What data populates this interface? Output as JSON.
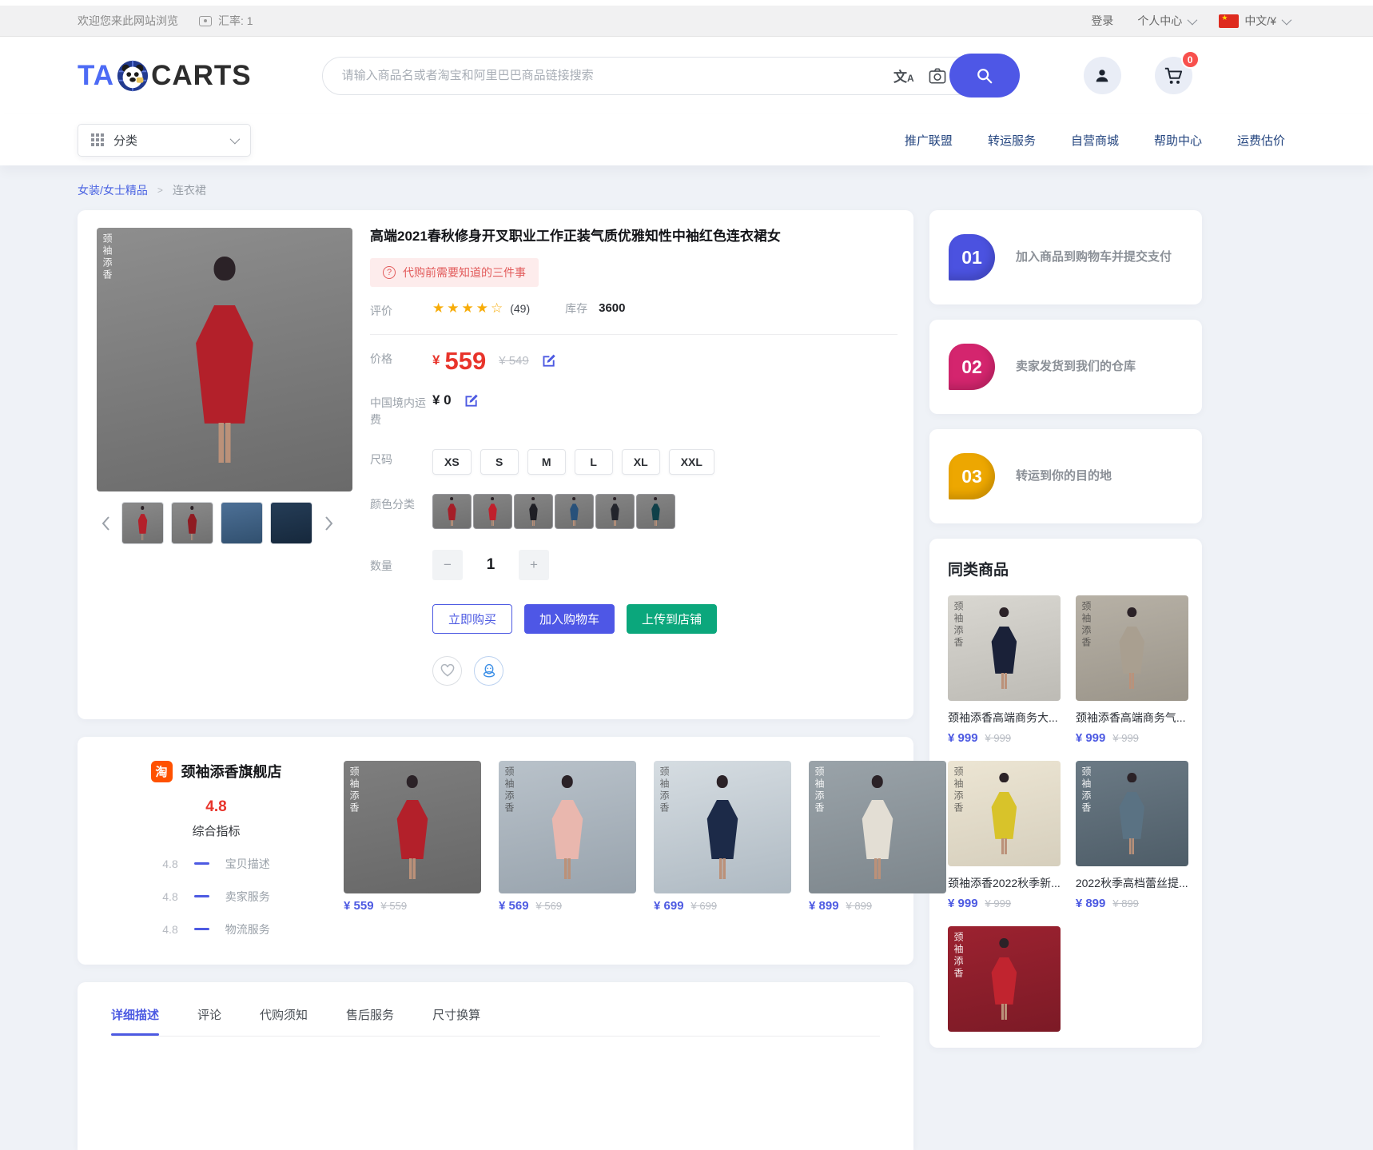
{
  "colors": {
    "accent_indigo": "#4e57e6",
    "price_red": "#e8342b",
    "green": "#0ba77c",
    "taobao_orange": "#ff5100",
    "badge_red": "#f8504d",
    "step1": "#4b52e0",
    "step2": "#d4256e",
    "step3": "#eda701",
    "nav_link": "#24457f",
    "star_gold": "#f7ac08"
  },
  "brand": {
    "logo_left": "TA",
    "logo_right": "CARTS",
    "watermark": "颈袖添香"
  },
  "topbar": {
    "welcome": "欢迎您来此网站浏览",
    "rate": "汇率: 1",
    "login": "登录",
    "account": "个人中心",
    "lang": "中文/¥"
  },
  "search": {
    "placeholder": "请输入商品名或者淘宝和阿里巴巴商品链接搜索",
    "cart_badge": "0"
  },
  "nav": {
    "category": "分类",
    "links": [
      "推广联盟",
      "转运服务",
      "自营商城",
      "帮助中心",
      "运费估价"
    ]
  },
  "breadcrumb": {
    "parent": "女装/女士精品",
    "sep": ">",
    "current": "连衣裙"
  },
  "product": {
    "title": "高端2021春秋修身开叉职业工作正装气质优雅知性中袖红色连衣裙女",
    "notice": "代购前需要知道的三件事",
    "labels": {
      "rating": "评价",
      "stock": "库存",
      "price": "价格",
      "shipping": "中国境内运费",
      "size": "尺码",
      "color": "颜色分类",
      "qty": "数量"
    },
    "rating_stars": "★★★★",
    "rating_half": "☆",
    "rating_count": "(49)",
    "stock": "3600",
    "currency": "¥",
    "price": "559",
    "old_price": "¥ 549",
    "shipping_fee": "¥ 0",
    "sizes": [
      "XS",
      "S",
      "M",
      "L",
      "XL",
      "XXL"
    ],
    "qty": "1",
    "minus": "−",
    "plus": "+",
    "buttons": {
      "buy": "立即购买",
      "cart": "加入购物车",
      "upload": "上传到店铺"
    },
    "main_img": {
      "bg1": "#8e8e8e",
      "bg2": "#6a6a6a",
      "dress": "#b3202a"
    },
    "thumbs": [
      {
        "bg1": "#8a8a8a",
        "bg2": "#707070",
        "dress": "#b3202a"
      },
      {
        "bg1": "#8a8a8a",
        "bg2": "#707070",
        "dress": "#8f1b22"
      },
      {
        "bg1": "#4d7096",
        "bg2": "#31506f",
        "dress": ""
      },
      {
        "bg1": "#253d57",
        "bg2": "#16283c",
        "dress": ""
      }
    ],
    "swatches": [
      "#a51e28",
      "#c0202c",
      "#1e1e24",
      "#28517a",
      "#22242b",
      "#104049"
    ]
  },
  "steps": [
    {
      "num": "01",
      "text": "加入商品到购物车并提交支付"
    },
    {
      "num": "02",
      "text": "卖家发货到我们的仓库"
    },
    {
      "num": "03",
      "text": "转运到你的目的地"
    }
  ],
  "similar": {
    "title": "同类商品",
    "items": [
      {
        "name": "颈袖添香高端商务大...",
        "price": "¥ 999",
        "old": "¥ 999",
        "img": {
          "bg1": "#d9d7d1",
          "bg2": "#bdbbb5",
          "dress": "#1a2138"
        }
      },
      {
        "name": "颈袖添香高端商务气...",
        "price": "¥ 999",
        "old": "¥ 999",
        "img": {
          "bg1": "#b7b1a6",
          "bg2": "#9b958a",
          "dress": "#a99f90"
        }
      },
      {
        "name": "颈袖添香2022秋季新...",
        "price": "¥ 999",
        "old": "¥ 999",
        "img": {
          "bg1": "#ece5d3",
          "bg2": "#d6cfbd",
          "dress": "#d8c32a"
        }
      },
      {
        "name": "2022秋季高档蕾丝提...",
        "price": "¥ 899",
        "old": "¥ 899",
        "img": {
          "bg1": "#6b7a85",
          "bg2": "#4e5d68",
          "dress": "#5a7283"
        }
      },
      {
        "name": "",
        "price": "",
        "old": "",
        "img": {
          "bg1": "#9c2230",
          "bg2": "#7c1a26",
          "dress": "#c1242f"
        }
      }
    ]
  },
  "shop": {
    "tao": "淘",
    "name": "颈袖添香旗舰店",
    "score": "4.8",
    "score_label": "综合指标",
    "metrics": [
      {
        "value": "4.8",
        "label": "宝贝描述"
      },
      {
        "value": "4.8",
        "label": "卖家服务"
      },
      {
        "value": "4.8",
        "label": "物流服务"
      }
    ],
    "items": [
      {
        "price": "¥ 559",
        "old": "¥ 559",
        "img": {
          "bg1": "#7e7e7e",
          "bg2": "#676767",
          "dress": "#b3202a"
        }
      },
      {
        "price": "¥ 569",
        "old": "¥ 569",
        "img": {
          "bg1": "#b9c2ca",
          "bg2": "#98a3ad",
          "dress": "#e9b7ae"
        }
      },
      {
        "price": "¥ 699",
        "old": "¥ 699",
        "img": {
          "bg1": "#d6dde2",
          "bg2": "#aeb9c2",
          "dress": "#1c2a48"
        }
      },
      {
        "price": "¥ 899",
        "old": "¥ 899",
        "img": {
          "bg1": "#9aa3a9",
          "bg2": "#7d868c",
          "dress": "#e3ded4"
        }
      }
    ]
  },
  "tabs": [
    "详细描述",
    "评论",
    "代购须知",
    "售后服务",
    "尺寸换算"
  ]
}
